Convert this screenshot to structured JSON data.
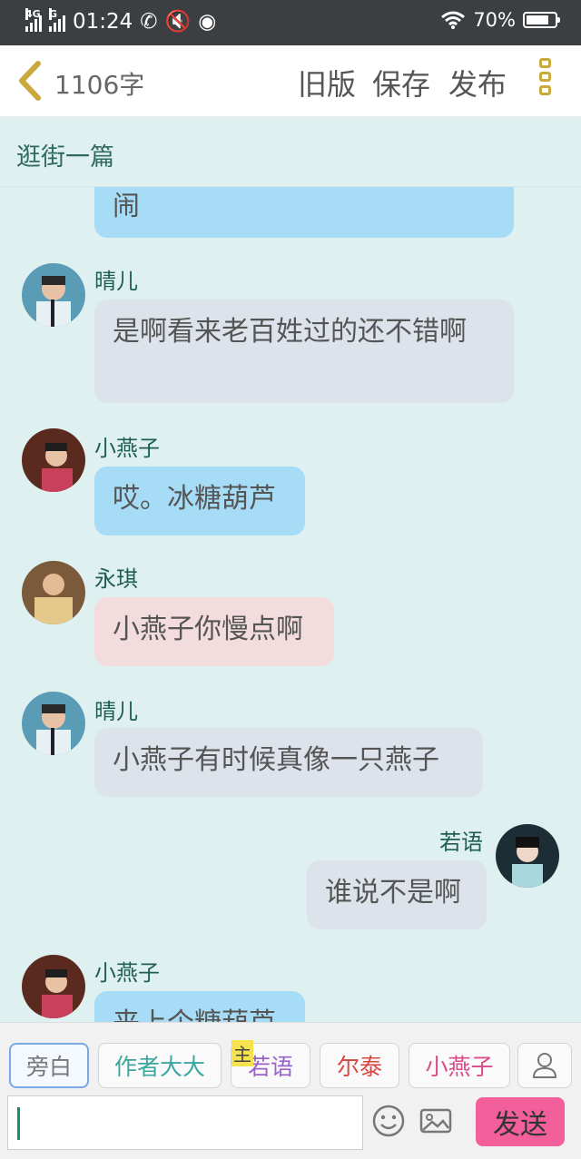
{
  "status": {
    "net1": "4G",
    "net2": "G",
    "time": "01:24",
    "battery": "70%"
  },
  "topbar": {
    "word_count": "1106字",
    "old_version": "旧版",
    "save": "保存",
    "publish": "发布"
  },
  "title": "逛街一篇",
  "messages": [
    {
      "name": "",
      "text": "闹"
    },
    {
      "name": "晴儿",
      "text": "是啊看来老百姓过的还不错啊"
    },
    {
      "name": "小燕子",
      "text": "哎。冰糖葫芦"
    },
    {
      "name": "永琪",
      "text": "小燕子你慢点啊"
    },
    {
      "name": "晴儿",
      "text": "小燕子有时候真像一只燕子"
    },
    {
      "name": "若语",
      "text": "谁说不是啊"
    },
    {
      "name": "小燕子",
      "text": "来上个糖葫芦"
    }
  ],
  "roles": {
    "narration": "旁白",
    "author": "作者大大",
    "main_tag": "主",
    "ruoyu": "若语",
    "ertai": "尔泰",
    "xiaoyanzi": "小燕子"
  },
  "send": "发送",
  "colors": {
    "send": "#f35f9b",
    "author": "#3aa6a0",
    "ruoyu": "#9b63c9",
    "ertai": "#d9453f",
    "xiaoyanzi": "#d94b8a"
  }
}
